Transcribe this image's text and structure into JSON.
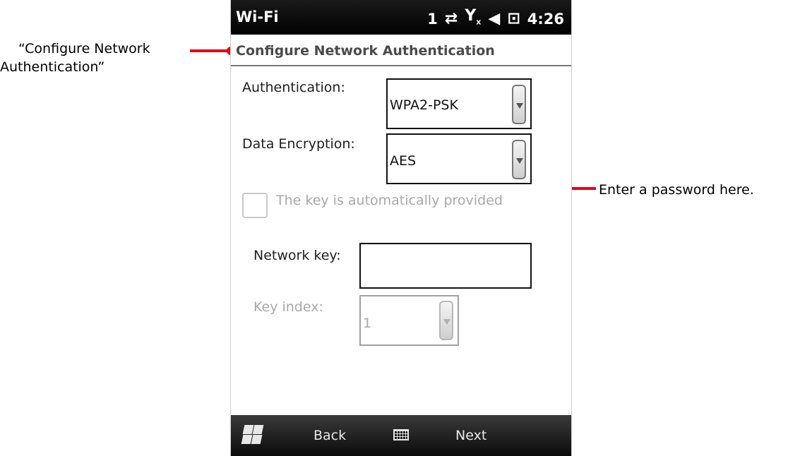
{
  "annotations": {
    "left_line1": "“Configure Network",
    "left_line2": "Authentication”",
    "right": "Enter a password here.",
    "accent": "#e30613"
  },
  "statusbar": {
    "title": "Wi-Fi",
    "signal_number": "1",
    "time": "4:26",
    "icons": [
      "data-transfer-icon",
      "no-signal-icon",
      "volume-muted-icon",
      "power-plug-icon"
    ]
  },
  "header": {
    "title": "Configure Network Authentication"
  },
  "form": {
    "authentication_label": "Authentication:",
    "authentication_value": "WPA2-PSK",
    "encryption_label": "Data Encryption:",
    "encryption_value": "AES",
    "auto_key_label": "The key is automatically provided",
    "auto_key_checked": false,
    "network_key_label": "Network key:",
    "network_key_value": "",
    "key_index_label": "Key index:",
    "key_index_value": "1"
  },
  "taskbar": {
    "back_label": "Back",
    "next_label": "Next"
  }
}
